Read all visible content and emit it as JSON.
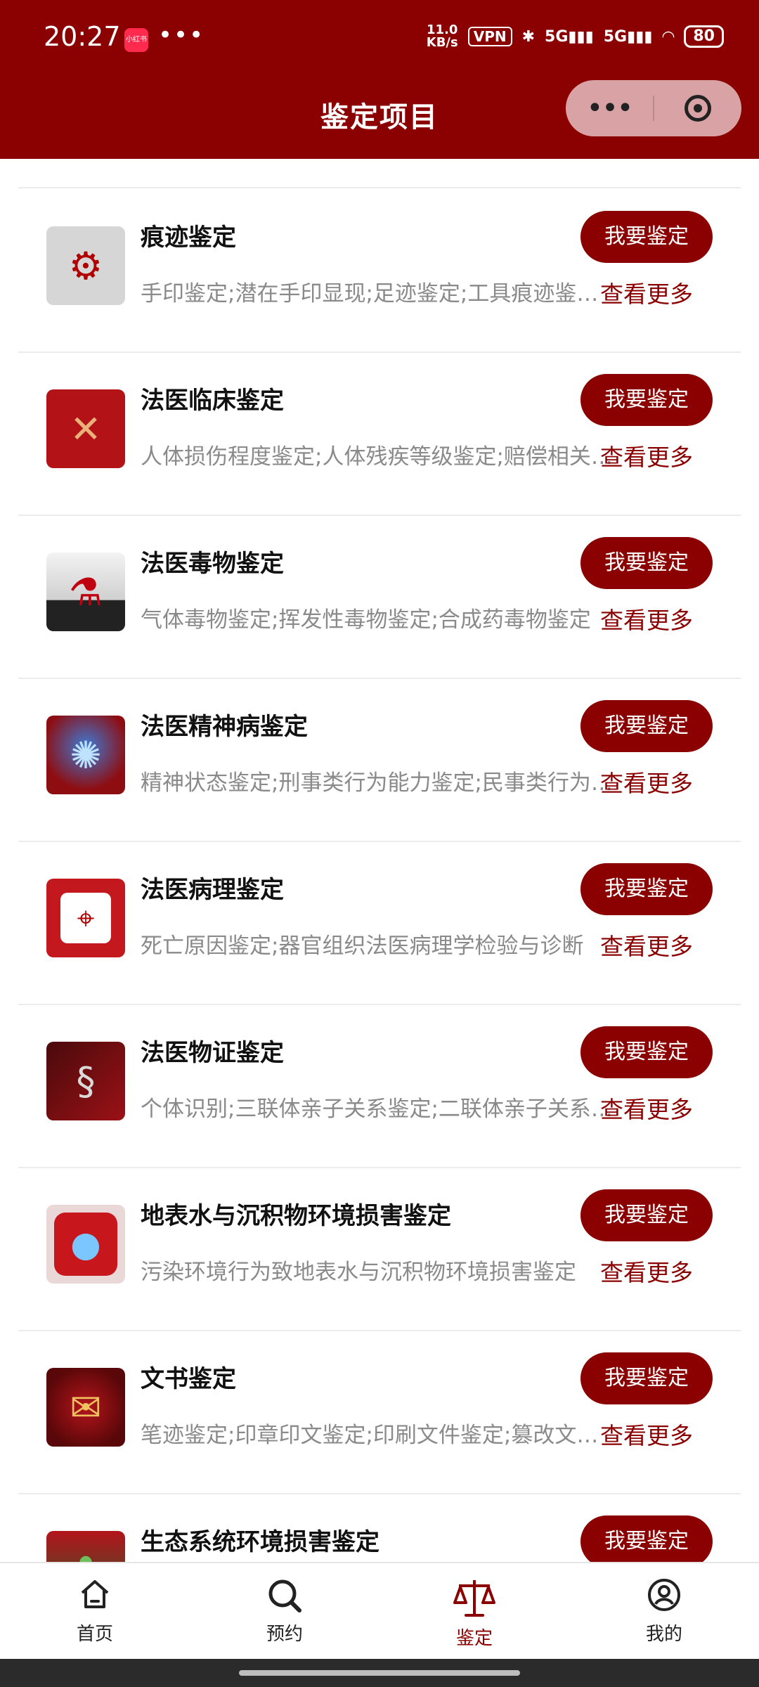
{
  "status_bar": {
    "time": "20:27",
    "app_badge": "小红书",
    "more": "•••",
    "net_speed_value": "11.0",
    "net_speed_unit": "KB/s",
    "vpn": "VPN",
    "bluetooth_icon": "bluetooth-icon",
    "signal1": "5G",
    "signal2": "5G",
    "battery": "80"
  },
  "navbar": {
    "title": "鉴定项目",
    "more_label": "•••",
    "close_icon": "target-circle-icon"
  },
  "items": [
    {
      "name": "痕迹鉴定",
      "desc": "手印鉴定;潜在手印显现;足迹鉴定;工具痕迹鉴定;枪弹痕迹鉴定",
      "button": "我要鉴定",
      "more": "查看更多",
      "icon": "magnifier-gear-icon"
    },
    {
      "name": "法医临床鉴定",
      "desc": "人体损伤程度鉴定;人体残疾等级鉴定;赔偿相关鉴定",
      "button": "我要鉴定",
      "more": "查看更多",
      "icon": "crossbones-medical-icon"
    },
    {
      "name": "法医毒物鉴定",
      "desc": "气体毒物鉴定;挥发性毒物鉴定;合成药毒物鉴定",
      "button": "我要鉴定",
      "more": "查看更多",
      "icon": "poison-flask-icon"
    },
    {
      "name": "法医精神病鉴定",
      "desc": "精神状态鉴定;刑事类行为能力鉴定;民事类行为能力鉴定",
      "button": "我要鉴定",
      "more": "查看更多",
      "icon": "brain-icon"
    },
    {
      "name": "法医病理鉴定",
      "desc": "死亡原因鉴定;器官组织法医病理学检验与诊断",
      "button": "我要鉴定",
      "more": "查看更多",
      "icon": "microscope-icon"
    },
    {
      "name": "法医物证鉴定",
      "desc": "个体识别;三联体亲子关系鉴定;二联体亲子关系鉴定",
      "button": "我要鉴定",
      "more": "查看更多",
      "icon": "dna-icon"
    },
    {
      "name": "地表水与沉积物环境损害鉴定",
      "desc": "污染环境行为致地表水与沉积物环境损害鉴定",
      "button": "我要鉴定",
      "more": "查看更多",
      "icon": "water-drop-scale-icon"
    },
    {
      "name": "文书鉴定",
      "desc": "笔迹鉴定;印章印文鉴定;印刷文件鉴定;篡改文件鉴定",
      "button": "我要鉴定",
      "more": "查看更多",
      "icon": "document-seal-icon"
    },
    {
      "name": "生态系统环境损害鉴定",
      "desc": "",
      "button": "我要鉴定",
      "more": "",
      "icon": "ecosystem-icon"
    }
  ],
  "tabbar": [
    {
      "label": "首页",
      "icon": "home-icon"
    },
    {
      "label": "预约",
      "icon": "search-icon"
    },
    {
      "label": "鉴定",
      "icon": "scale-icon"
    },
    {
      "label": "我的",
      "icon": "user-icon"
    }
  ],
  "colors": {
    "primary": "#8b0000",
    "capsule": "#d9a3a5"
  }
}
